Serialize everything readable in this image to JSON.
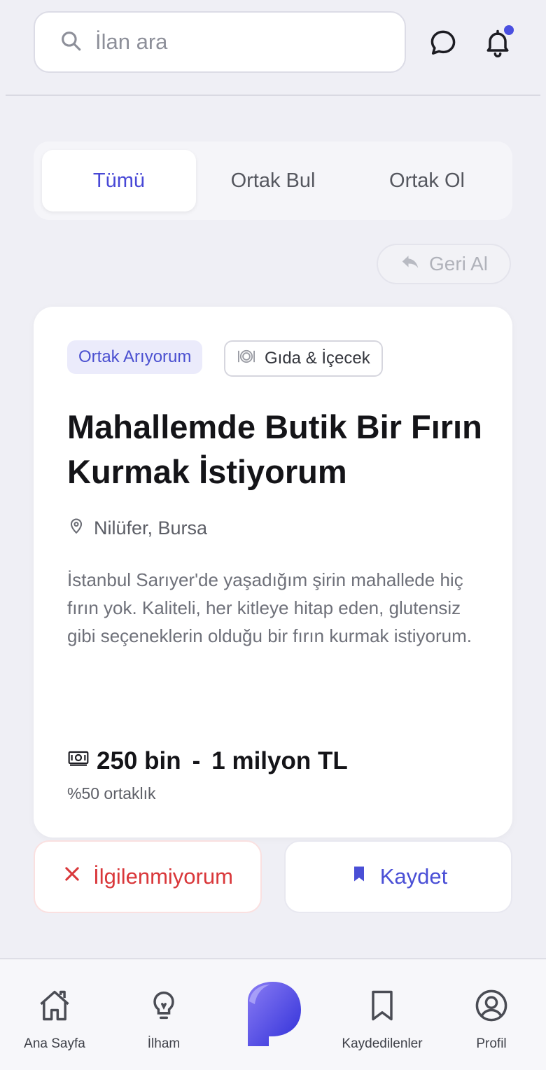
{
  "header": {
    "search_placeholder": "İlan ara",
    "icons": [
      "search-icon",
      "chat-icon",
      "bell-icon"
    ],
    "has_notification": true
  },
  "tabs": [
    {
      "label": "Tümü",
      "active": true
    },
    {
      "label": "Ortak Bul",
      "active": false
    },
    {
      "label": "Ortak Ol",
      "active": false
    }
  ],
  "undo": {
    "label": "Geri Al",
    "icon": "undo-arrow-icon"
  },
  "listing": {
    "type_badge": "Ortak Arıyorum",
    "category": "Gıda & İçecek",
    "category_icon": "plate-icon",
    "title": "Mahallemde Butik Bir Fırın Kurmak İstiyorum",
    "location": "Nilüfer, Bursa",
    "description": "İstanbul Sarıyer'de yaşadığım şirin mahallede hiç fırın yok. Kaliteli, her kitleye hitap eden, glutensiz gibi seçeneklerin olduğu bir fırın kurmak istiyorum.",
    "budget_min": "250 bin",
    "budget_sep": "-",
    "budget_max": "1 milyon TL",
    "share": "%50 ortaklık"
  },
  "actions": {
    "pass_label": "İlgilenmiyorum",
    "save_label": "Kaydet"
  },
  "nav": {
    "items": [
      {
        "label": "Ana Sayfa",
        "icon": "home-icon"
      },
      {
        "label": "İlham",
        "icon": "lightbulb-icon"
      },
      {
        "label": "",
        "icon": "brand-logo"
      },
      {
        "label": "Kaydedilenler",
        "icon": "bookmark-icon"
      },
      {
        "label": "Profil",
        "icon": "user-icon"
      }
    ]
  },
  "colors": {
    "accent": "#4a4fd6",
    "danger": "#d9373a",
    "background": "#efeff5",
    "card": "#ffffff"
  }
}
